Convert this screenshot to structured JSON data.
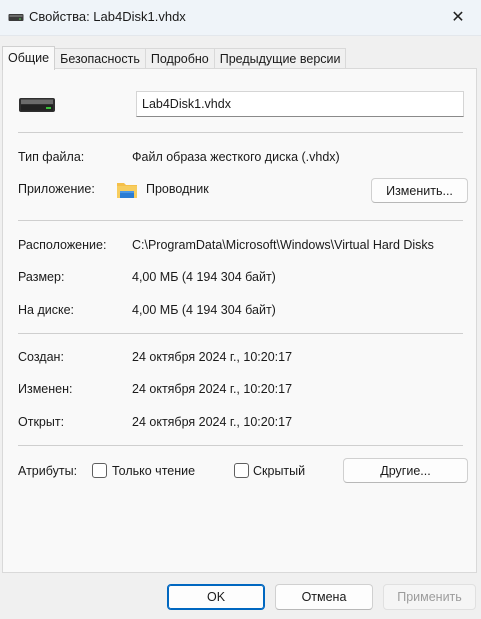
{
  "window": {
    "title": "Свойства: Lab4Disk1.vhdx",
    "close_glyph": "✕"
  },
  "tabs": [
    {
      "label": "Общие",
      "active": true
    },
    {
      "label": "Безопасность",
      "active": false
    },
    {
      "label": "Подробно",
      "active": false
    },
    {
      "label": "Предыдущие версии",
      "active": false
    }
  ],
  "general": {
    "file_name": "Lab4Disk1.vhdx",
    "file_icon": "virtual-disk-icon",
    "file_type_label": "Тип файла:",
    "file_type_value": "Файл образа жесткого диска (.vhdx)",
    "app_label": "Приложение:",
    "app_icon": "folder-explorer-icon",
    "app_value": "Проводник",
    "change_button": "Изменить...",
    "location_label": "Расположение:",
    "location_value": "C:\\ProgramData\\Microsoft\\Windows\\Virtual Hard Disks",
    "size_label": "Размер:",
    "size_value": "4,00 МБ (4 194 304 байт)",
    "disk_size_label": "На диске:",
    "disk_size_value": "4,00 МБ (4 194 304 байт)",
    "created_label": "Создан:",
    "created_value": "24 октября 2024 г., 10:20:17",
    "modified_label": "Изменен:",
    "modified_value": "24 октября 2024 г., 10:20:17",
    "accessed_label": "Открыт:",
    "accessed_value": "24 октября 2024 г., 10:20:17",
    "attributes_label": "Атрибуты:",
    "readonly_label": "Только чтение",
    "readonly_checked": false,
    "hidden_label": "Скрытый",
    "hidden_checked": false,
    "other_button": "Другие..."
  },
  "footer": {
    "ok": "OK",
    "cancel": "Отмена",
    "apply": "Применить"
  },
  "colors": {
    "accent": "#0067c0",
    "folder_yellow": "#f5c04a",
    "folder_blue": "#2b7cd3"
  }
}
